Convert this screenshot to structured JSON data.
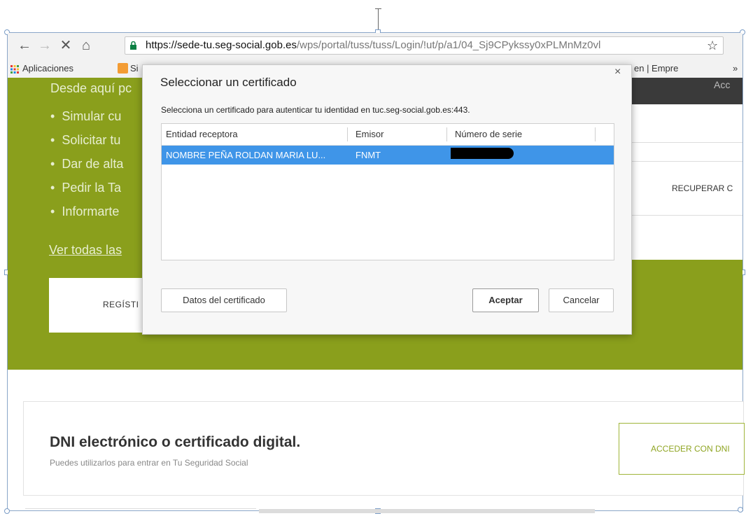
{
  "browser": {
    "url_domain": "https://sede-tu.seg-social.gob.es",
    "url_path": "/wps/portal/tuss/tuss/Login/!ut/p/a1/04_Sj9CPykssy0xPLMnMz0vl",
    "bookmarks": {
      "apps_label": "Aplicaciones",
      "item_truncated": "Si",
      "item_right": "en | Empre",
      "overflow": "»"
    }
  },
  "page": {
    "intro_text": "Desde aquí pc",
    "bullets": [
      "Simular cu",
      "Solicitar tu",
      "Dar de alta",
      "Pedir la Ta",
      "Informarte"
    ],
    "more_link": "Ver todas las",
    "register_button": "REGÍSTI",
    "top_right_bar": "Acc",
    "recover_button": "RECUPERAR C",
    "card_title": "DNI electrónico o certificado digital.",
    "card_subtitle": "Puedes utilizarlos para entrar en Tu Seguridad Social",
    "access_button": "ACCEDER CON DNI"
  },
  "dialog": {
    "title": "Seleccionar un certificado",
    "close": "×",
    "description": "Selecciona un certificado para autenticar tu identidad en tuc.seg-social.gob.es:443.",
    "columns": [
      "Entidad receptora",
      "Emisor",
      "Número de serie"
    ],
    "rows": [
      {
        "subject": "NOMBRE PEÑA ROLDAN MARIA LU...",
        "issuer": "FNMT",
        "serial": ""
      }
    ],
    "details_button": "Datos del certificado",
    "accept_button": "Aceptar",
    "cancel_button": "Cancelar"
  }
}
